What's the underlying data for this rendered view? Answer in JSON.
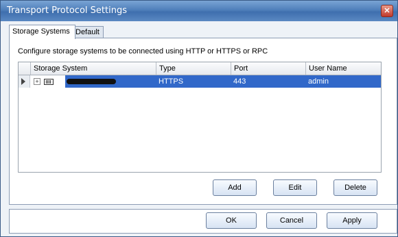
{
  "window": {
    "title": "Transport Protocol Settings",
    "close_label": "✕"
  },
  "tabs": [
    {
      "label": "Storage Systems"
    },
    {
      "label": "Default"
    }
  ],
  "description": "Configure storage systems to be connected using  HTTP or HTTPS or RPC",
  "table": {
    "headers": [
      "Storage System",
      "Type",
      "Port",
      "User Name"
    ],
    "rows": [
      {
        "storage_system": "",
        "type": "HTTPS",
        "port": "443",
        "user_name": "admin"
      }
    ]
  },
  "buttons": {
    "add": "Add",
    "edit": "Edit",
    "delete": "Delete",
    "ok": "OK",
    "cancel": "Cancel",
    "apply": "Apply"
  },
  "icons": [
    "close-icon",
    "row-indicator-icon",
    "expand-icon",
    "storage-device-icon"
  ]
}
